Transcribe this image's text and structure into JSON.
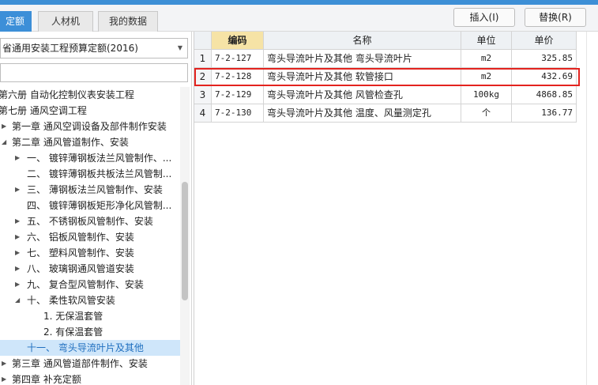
{
  "tabs": {
    "quota_label": "定额",
    "labor_label": "人材机",
    "mydata_label": "我的数据"
  },
  "toolbar": {
    "insert_label": "插入(I)",
    "replace_label": "替换(R)"
  },
  "library": {
    "selected": "省通用安装工程预算定额(2016)"
  },
  "tree": {
    "items": [
      {
        "label": "第六册 自动化控制仪表安装工程"
      },
      {
        "label": "第七册 通风空调工程"
      },
      {
        "label": "第一章 通风空调设备及部件制作安装"
      },
      {
        "label": "第二章 通风管道制作、安装"
      },
      {
        "label": "一、 镀锌薄钢板法兰风管制作、..."
      },
      {
        "label": "二、 镀锌薄钢板共板法兰风管制..."
      },
      {
        "label": "三、 薄钢板法兰风管制作、安装"
      },
      {
        "label": "四、 镀锌薄钢板矩形净化风管制..."
      },
      {
        "label": "五、 不锈钢板风管制作、安装"
      },
      {
        "label": "六、 铝板风管制作、安装"
      },
      {
        "label": "七、 塑料风管制作、安装"
      },
      {
        "label": "八、 玻璃钢通风管道安装"
      },
      {
        "label": "九、 复合型风管制作、安装"
      },
      {
        "label": "十、 柔性软风管安装"
      },
      {
        "label": "1. 无保温套管"
      },
      {
        "label": "2. 有保温套管"
      },
      {
        "label": "十一、 弯头导流叶片及其他"
      },
      {
        "label": "第三章 通风管道部件制作、安装"
      },
      {
        "label": "第四章 补充定额"
      }
    ]
  },
  "table": {
    "headers": {
      "code": "编码",
      "name": "名称",
      "unit": "单位",
      "price": "单价"
    },
    "rows": [
      {
        "num": "1",
        "code": "7-2-127",
        "name": "弯头导流叶片及其他 弯头导流叶片",
        "unit": "m2",
        "price": "325.85"
      },
      {
        "num": "2",
        "code": "7-2-128",
        "name": "弯头导流叶片及其他 软管接口",
        "unit": "m2",
        "price": "432.69"
      },
      {
        "num": "3",
        "code": "7-2-129",
        "name": "弯头导流叶片及其他 风管检查孔",
        "unit": "100kg",
        "price": "4868.85"
      },
      {
        "num": "4",
        "code": "7-2-130",
        "name": "弯头导流叶片及其他 温度、风量测定孔",
        "unit": "个",
        "price": "136.77"
      }
    ]
  }
}
